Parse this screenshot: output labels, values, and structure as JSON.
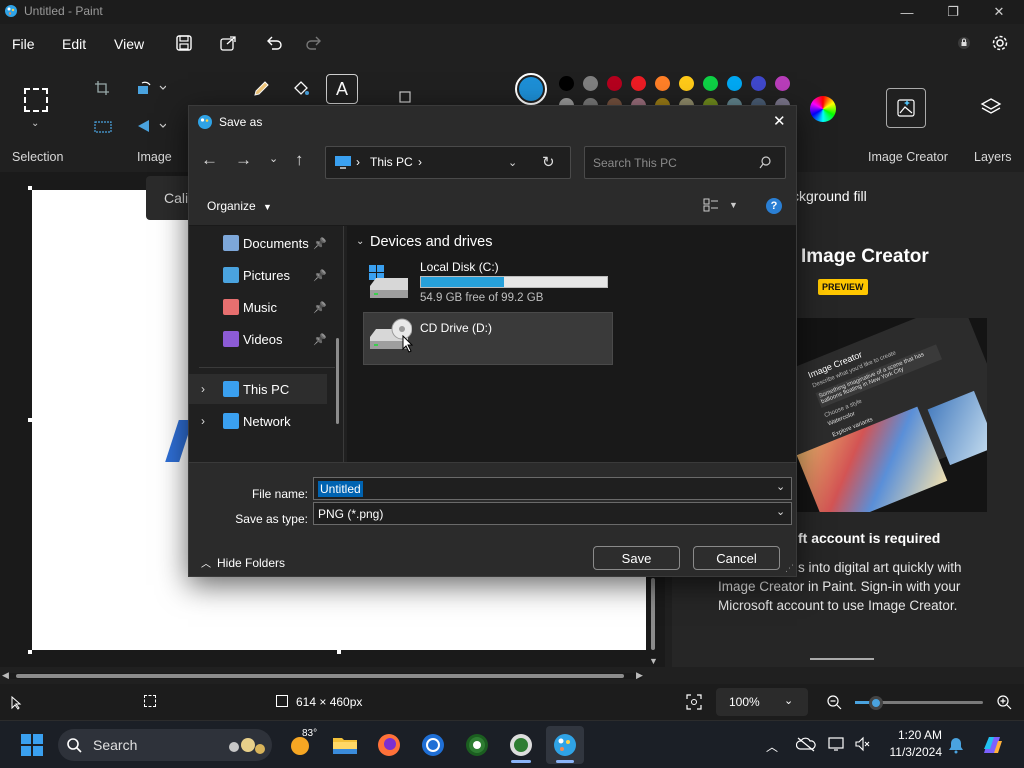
{
  "app": {
    "title": "Untitled - Paint",
    "window_controls": [
      "minimize-icon",
      "restore-icon",
      "close-icon"
    ]
  },
  "menu": {
    "items": [
      "File",
      "Edit",
      "View"
    ],
    "toolbar_icons": [
      "save-icon",
      "share-icon",
      "undo-icon",
      "redo-icon"
    ]
  },
  "ribbon": {
    "groups": {
      "selection": "Selection",
      "image": "Image",
      "image_creator": "Image Creator",
      "layers": "Layers"
    },
    "palette_row1": [
      "#000000",
      "#7f7f7f",
      "#b5001e",
      "#ec1c24",
      "#ff7f27",
      "#ffca18",
      "#0ed145",
      "#00a8f3",
      "#3f48cc",
      "#b83dba"
    ],
    "palette_row2": [
      "#ffffff",
      "#c3c3c3",
      "#b97a57",
      "#ffaec8",
      "#ffc90e",
      "#eee8aa",
      "#b5e61d",
      "#99d9ea",
      "#7092be",
      "#c8bfe7"
    ],
    "active_color": "#1d8fd6"
  },
  "canvas": {
    "font_tooltip": "Cali"
  },
  "right_panel": {
    "header_text": "ckground fill",
    "title": "Image Creator",
    "badge": "PREVIEW",
    "account_title": "ft account is required",
    "description": "s into digital art quickly with Image Creator in Paint. Sign-in with your Microsoft account to use Image Creator.",
    "mock_ui": {
      "heading": "Image Creator",
      "prompt_label": "Describe what you'd like to create",
      "prompt_text": "Something imaginative of a scene that has balloons floating in New York City",
      "choose_style": "Choose a style",
      "style_option": "Watercolor",
      "explore": "Explore variants"
    }
  },
  "status": {
    "canvas_size": "614 × 460px",
    "zoom": "100%"
  },
  "dialog": {
    "title": "Save as",
    "breadcrumb": "This PC",
    "search_placeholder": "Search This PC",
    "organize": "Organize",
    "nav_items": [
      {
        "label": "Documents",
        "icon": "documents-icon",
        "pinned": true
      },
      {
        "label": "Pictures",
        "icon": "pictures-icon",
        "pinned": true
      },
      {
        "label": "Music",
        "icon": "music-icon",
        "pinned": true
      },
      {
        "label": "Videos",
        "icon": "videos-icon",
        "pinned": true
      },
      {
        "label": "This PC",
        "icon": "this-pc-icon",
        "selected": true
      },
      {
        "label": "Network",
        "icon": "network-icon"
      }
    ],
    "section_header": "Devices and drives",
    "drives": [
      {
        "name": "Local Disk (C:)",
        "free_text": "54.9 GB free of 99.2 GB",
        "used_fraction": 0.446
      },
      {
        "name": "CD Drive (D:)"
      }
    ],
    "file_name_label": "File name:",
    "file_name_value": "Untitled",
    "save_type_label": "Save as type:",
    "save_type_value": "PNG (*.png)",
    "hide_folders": "Hide Folders",
    "save_button": "Save",
    "cancel_button": "Cancel"
  },
  "taskbar": {
    "search_label": "Search",
    "weather": "83°",
    "time": "1:20 AM",
    "date": "11/3/2024"
  }
}
